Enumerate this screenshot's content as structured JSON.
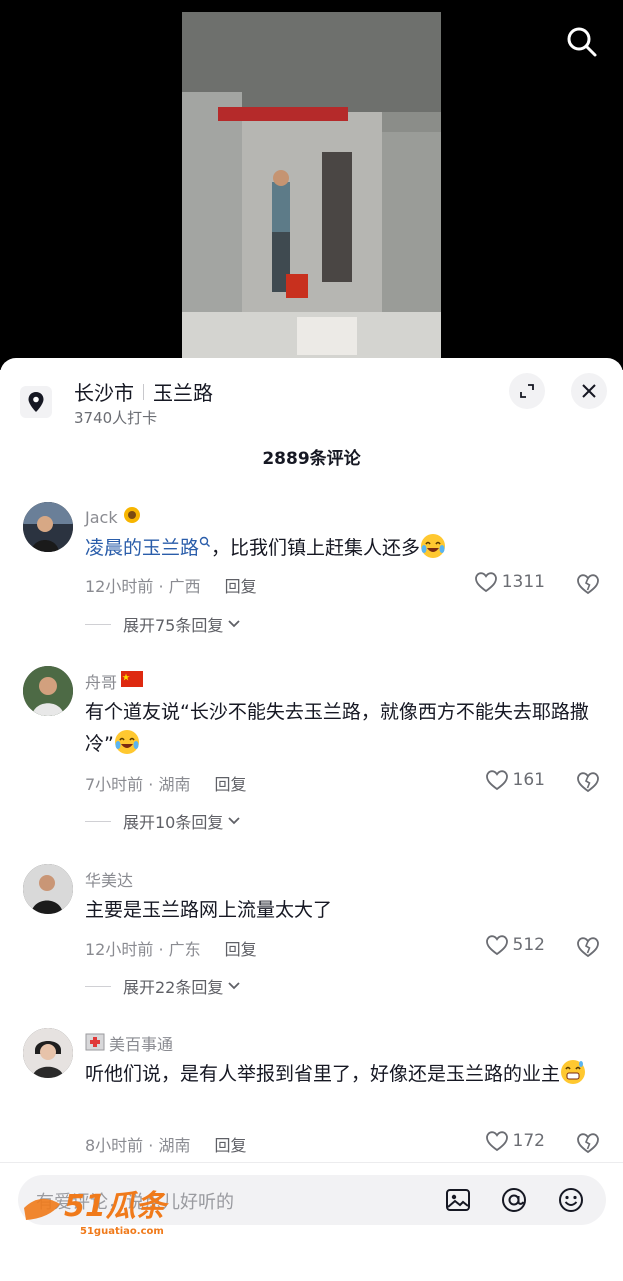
{
  "video": {
    "search_icon": "search-icon"
  },
  "location": {
    "city": "长沙市",
    "road": "玉兰路",
    "checkins": "3740人打卡",
    "pin_icon": "location-pin-icon",
    "expand_icon": "expand-icon",
    "close_icon": "close-icon"
  },
  "comments_header": {
    "count": "2889条评论"
  },
  "comments": [
    {
      "user": "Jack",
      "badge": "sunflower",
      "text_link": "凌晨的玉兰路",
      "text": "，比我们镇上赶集人还多",
      "emoji": "laughing-crying",
      "time_place": "12小时前 · 广西",
      "reply": "回复",
      "likes": "1311",
      "expand": "展开75条回复"
    },
    {
      "user": "舟哥",
      "badge": "china-flag",
      "text": "有个道友说“长沙不能失去玉兰路，就像西方不能失去耶路撒冷”",
      "emoji": "laughing-crying",
      "time_place": "7小时前 · 湖南",
      "reply": "回复",
      "likes": "161",
      "expand": "展开10条回复"
    },
    {
      "user": "华美达",
      "text": "主要是玉兰路网上流量太大了",
      "time_place": "12小时前 · 广东",
      "reply": "回复",
      "likes": "512",
      "expand": "展开22条回复"
    },
    {
      "user": "美百事通",
      "badge": "hospital-icon",
      "text": "听他们说，是有人举报到省里了，好像还是玉兰路的业主",
      "emoji": "grinning-sweat",
      "time_place": "8小时前 · 湖南",
      "reply": "回复",
      "likes": "172"
    }
  ],
  "composer": {
    "placeholder": "有爱评论，说点儿好听的",
    "image_icon": "image-icon",
    "mention_icon": "at-icon",
    "emoji_icon": "emoji-icon"
  },
  "watermark": {
    "brand": "51瓜条",
    "url": "51guatiao.com"
  },
  "colors": {
    "link": "#2a5daa",
    "text": "#161823",
    "muted": "#8a8b91"
  }
}
